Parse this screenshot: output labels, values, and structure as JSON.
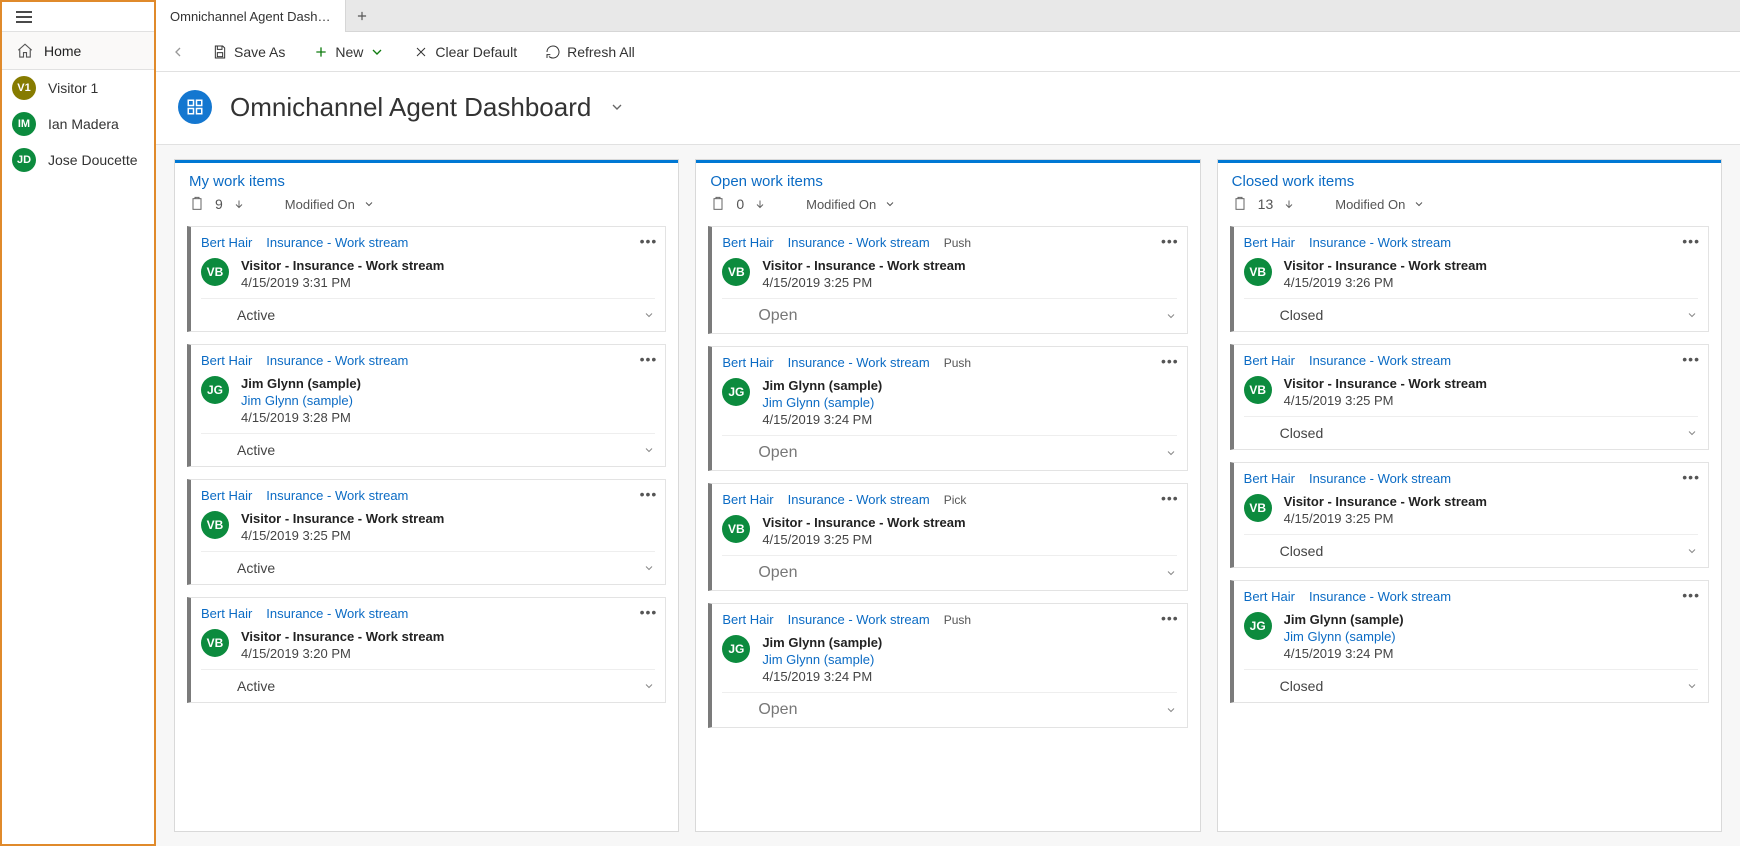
{
  "sidebar": {
    "home_label": "Home",
    "items": [
      {
        "initials": "V1",
        "name": "Visitor 1",
        "avatarClass": "av-olive"
      },
      {
        "initials": "IM",
        "name": "Ian Madera",
        "avatarClass": "av-green"
      },
      {
        "initials": "JD",
        "name": "Jose Doucette",
        "avatarClass": "av-green"
      }
    ]
  },
  "tabs": {
    "active_label": "Omnichannel Agent Dashbo..."
  },
  "commands": {
    "save_as": "Save As",
    "new": "New",
    "clear_default": "Clear Default",
    "refresh_all": "Refresh All"
  },
  "page": {
    "title": "Omnichannel Agent Dashboard"
  },
  "columns": [
    {
      "title": "My work items",
      "count": "9",
      "sort_by": "Modified On",
      "cards": [
        {
          "assignee": "Bert Hair",
          "stream": "Insurance - Work stream",
          "avatar": "VB",
          "avClass": "av-green",
          "subject": "Visitor - Insurance - Work stream",
          "link": "",
          "time": "4/15/2019 3:31 PM",
          "status": "Active",
          "openStyle": false
        },
        {
          "assignee": "Bert Hair",
          "stream": "Insurance - Work stream",
          "avatar": "JG",
          "avClass": "av-green",
          "subject": "Jim Glynn (sample)",
          "link": "Jim Glynn (sample)",
          "time": "4/15/2019 3:28 PM",
          "status": "Active",
          "openStyle": false
        },
        {
          "assignee": "Bert Hair",
          "stream": "Insurance - Work stream",
          "avatar": "VB",
          "avClass": "av-green",
          "subject": "Visitor - Insurance - Work stream",
          "link": "",
          "time": "4/15/2019 3:25 PM",
          "status": "Active",
          "openStyle": false
        },
        {
          "assignee": "Bert Hair",
          "stream": "Insurance - Work stream",
          "avatar": "VB",
          "avClass": "av-green",
          "subject": "Visitor - Insurance - Work stream",
          "link": "",
          "time": "4/15/2019 3:20 PM",
          "status": "Active",
          "openStyle": false
        }
      ]
    },
    {
      "title": "Open work items",
      "count": "0",
      "sort_by": "Modified On",
      "cards": [
        {
          "assignee": "Bert Hair",
          "stream": "Insurance - Work stream",
          "badge": "Push",
          "avatar": "VB",
          "avClass": "av-green",
          "subject": "Visitor - Insurance - Work stream",
          "link": "",
          "time": "4/15/2019 3:25 PM",
          "status": "Open",
          "openStyle": true
        },
        {
          "assignee": "Bert Hair",
          "stream": "Insurance - Work stream",
          "badge": "Push",
          "avatar": "JG",
          "avClass": "av-green",
          "subject": "Jim Glynn (sample)",
          "link": "Jim Glynn (sample)",
          "time": "4/15/2019 3:24 PM",
          "status": "Open",
          "openStyle": true
        },
        {
          "assignee": "Bert Hair",
          "stream": "Insurance - Work stream",
          "badge": "Pick",
          "avatar": "VB",
          "avClass": "av-green",
          "subject": "Visitor - Insurance - Work stream",
          "link": "",
          "time": "4/15/2019 3:25 PM",
          "status": "Open",
          "openStyle": true
        },
        {
          "assignee": "Bert Hair",
          "stream": "Insurance - Work stream",
          "badge": "Push",
          "avatar": "JG",
          "avClass": "av-green",
          "subject": "Jim Glynn (sample)",
          "link": "Jim Glynn (sample)",
          "time": "4/15/2019 3:24 PM",
          "status": "Open",
          "openStyle": true
        }
      ]
    },
    {
      "title": "Closed work items",
      "count": "13",
      "sort_by": "Modified On",
      "cards": [
        {
          "assignee": "Bert Hair",
          "stream": "Insurance - Work stream",
          "avatar": "VB",
          "avClass": "av-green",
          "subject": "Visitor - Insurance - Work stream",
          "link": "",
          "time": "4/15/2019 3:26 PM",
          "status": "Closed",
          "openStyle": false
        },
        {
          "assignee": "Bert Hair",
          "stream": "Insurance - Work stream",
          "avatar": "VB",
          "avClass": "av-green",
          "subject": "Visitor - Insurance - Work stream",
          "link": "",
          "time": "4/15/2019 3:25 PM",
          "status": "Closed",
          "openStyle": false
        },
        {
          "assignee": "Bert Hair",
          "stream": "Insurance - Work stream",
          "avatar": "VB",
          "avClass": "av-green",
          "subject": "Visitor - Insurance - Work stream",
          "link": "",
          "time": "4/15/2019 3:25 PM",
          "status": "Closed",
          "openStyle": false
        },
        {
          "assignee": "Bert Hair",
          "stream": "Insurance - Work stream",
          "avatar": "JG",
          "avClass": "av-green",
          "subject": "Jim Glynn (sample)",
          "link": "Jim Glynn (sample)",
          "time": "4/15/2019 3:24 PM",
          "status": "Closed",
          "openStyle": false
        }
      ]
    }
  ]
}
